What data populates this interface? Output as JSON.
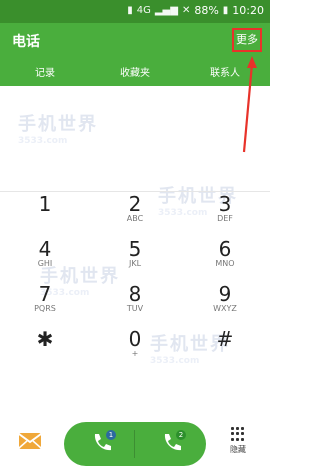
{
  "status_bar": {
    "battery": "88%",
    "time": "10:20"
  },
  "app_bar": {
    "title": "电话",
    "more_label": "更多"
  },
  "tabs": [
    {
      "label": "记录"
    },
    {
      "label": "收藏夹"
    },
    {
      "label": "联系人"
    }
  ],
  "keypad": [
    {
      "num": "1",
      "sub": ""
    },
    {
      "num": "2",
      "sub": "ABC"
    },
    {
      "num": "3",
      "sub": "DEF"
    },
    {
      "num": "4",
      "sub": "GHI"
    },
    {
      "num": "5",
      "sub": "JKL"
    },
    {
      "num": "6",
      "sub": "MNO"
    },
    {
      "num": "7",
      "sub": "PQRS"
    },
    {
      "num": "8",
      "sub": "TUV"
    },
    {
      "num": "9",
      "sub": "WXYZ"
    },
    {
      "num": "✱",
      "sub": ""
    },
    {
      "num": "0",
      "sub": "+"
    },
    {
      "num": "#",
      "sub": ""
    }
  ],
  "bottom": {
    "hide_label": "隐藏",
    "sim1": "1",
    "sim2": "2"
  },
  "watermark": {
    "brand": "手机世界",
    "site": "3533.com"
  },
  "colors": {
    "green": "#4aae3d",
    "dark_green": "#3a8f2c",
    "red_highlight": "#e8322a"
  }
}
